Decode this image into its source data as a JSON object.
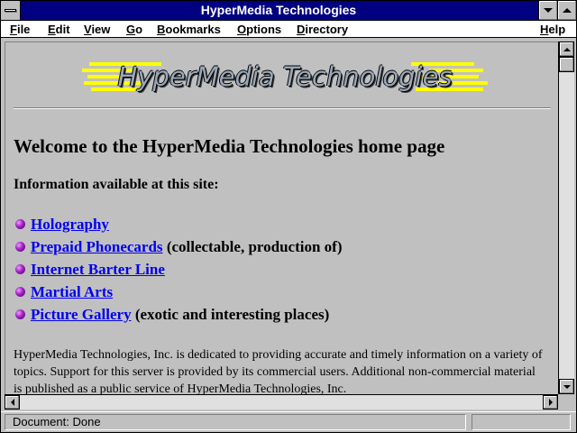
{
  "window": {
    "title": "HyperMedia Technologies"
  },
  "menu": [
    {
      "u": "F",
      "rest": "ile"
    },
    {
      "u": "E",
      "rest": "dit"
    },
    {
      "u": "V",
      "rest": "iew"
    },
    {
      "u": "G",
      "rest": "o"
    },
    {
      "u": "B",
      "rest": "ookmarks"
    },
    {
      "u": "O",
      "rest": "ptions"
    },
    {
      "u": "D",
      "rest": "irectory"
    },
    {
      "u": "H",
      "rest": "elp"
    }
  ],
  "page": {
    "logo_text": "HyperMedia Technologies",
    "heading": "Welcome to the HyperMedia Technologies home page",
    "subheading": "Information available at this site:",
    "links": [
      {
        "label": "Holography",
        "note": ""
      },
      {
        "label": "Prepaid Phonecards",
        "note": " (collectable, production of)"
      },
      {
        "label": "Internet Barter Line",
        "note": ""
      },
      {
        "label": "Martial Arts",
        "note": ""
      },
      {
        "label": "Picture Gallery",
        "note": " (exotic and interesting places)"
      }
    ],
    "paragraph": "HyperMedia Technologies, Inc. is dedicated to providing accurate and timely information on a variety of topics. Support for this server is provided by its commercial users. Additional non-commercial material is published as a public service of HyperMedia Technologies, Inc."
  },
  "status": {
    "text": "Document: Done"
  },
  "icons": {
    "system_menu": "system-menu-icon",
    "minimize": "minimize-icon",
    "maximize": "maximize-icon",
    "bullet": "purple-ball-bullet-icon"
  },
  "colors": {
    "titlebar": "#000080",
    "link": "#0000ee",
    "bullet": "#a020c0",
    "logo_stripes": "#ffff00"
  }
}
